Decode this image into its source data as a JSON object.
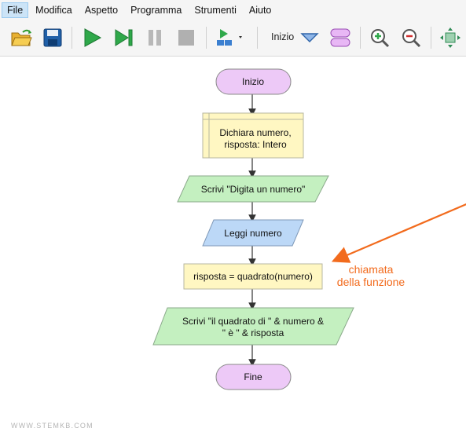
{
  "menu": {
    "file": "File",
    "modifica": "Modifica",
    "aspetto": "Aspetto",
    "programma": "Programma",
    "strumenti": "Strumenti",
    "aiuto": "Aiuto"
  },
  "toolbar": {
    "shape_selector_label": "Inizio"
  },
  "flowchart": {
    "start": "Inizio",
    "declare_line1": "Dichiara numero,",
    "declare_line2": "risposta: Intero",
    "output1": "Scrivi \"Digita un numero\"",
    "input": "Leggi numero",
    "assign": "risposta = quadrato(numero)",
    "output2_line1": "Scrivi \"il quadrato di \" & numero &",
    "output2_line2": "\" è \" & risposta",
    "end": "Fine"
  },
  "annotation": {
    "line1": "chiamata",
    "line2": "della funzione",
    "color": "#f26b1d"
  },
  "watermark": "WWW.STEMKB.COM",
  "colors": {
    "terminal_fill": "#edc9f7",
    "declare_fill": "#fff7c2",
    "output_fill": "#c4f0c0",
    "input_fill": "#bcd8f7",
    "assign_fill": "#fff7c2"
  }
}
